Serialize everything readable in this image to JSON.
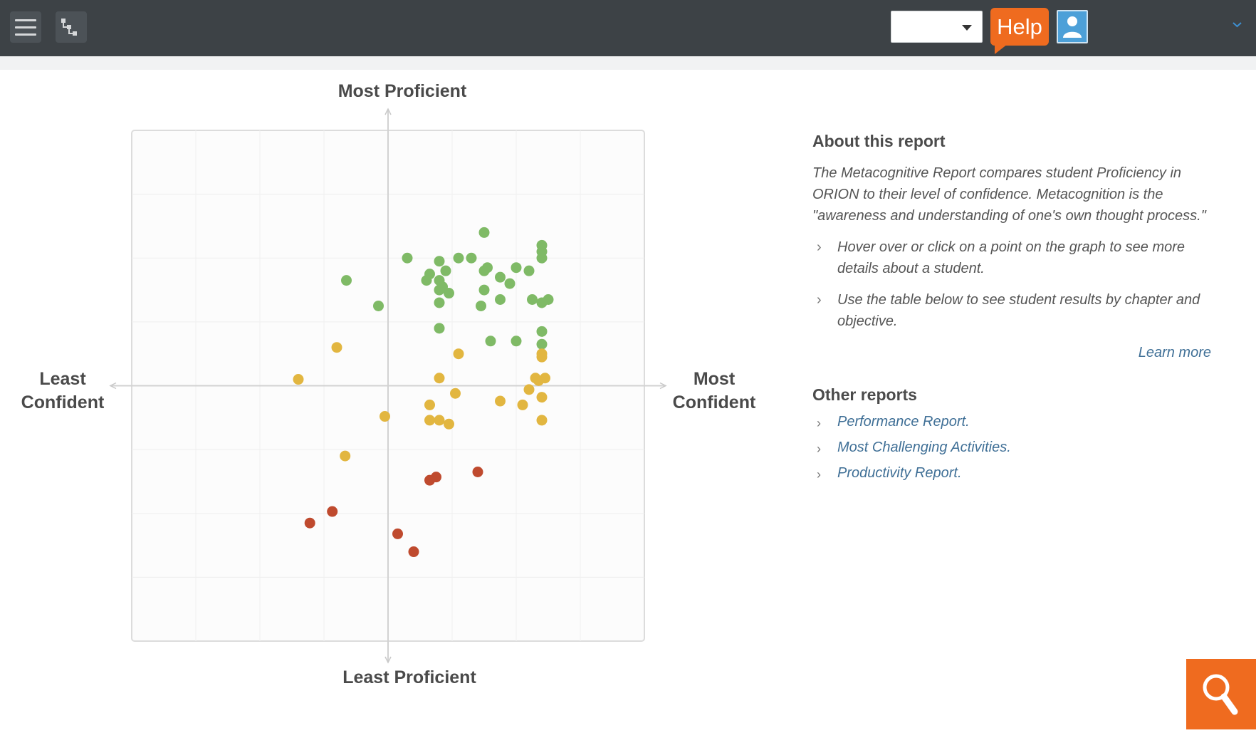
{
  "header": {
    "select_value": "",
    "help_label": "Help",
    "icons": [
      "menu-icon",
      "hierarchy-icon",
      "user-icon",
      "chevron-down-icon"
    ]
  },
  "chart": {
    "top_label": "Most Proficient",
    "bottom_label": "Least Proficient",
    "left_label_line1": "Least",
    "left_label_line2": "Confident",
    "right_label_line1": "Most",
    "right_label_line2": "Confident"
  },
  "chart_data": {
    "type": "scatter",
    "xlabel": "Confidence",
    "ylabel": "Proficiency",
    "xlim": [
      -4,
      4
    ],
    "ylim": [
      -4,
      4
    ],
    "grid": true,
    "colors": {
      "high": "#7fba66",
      "mid": "#e2b640",
      "low": "#bf4a2e"
    },
    "series": [
      {
        "group": "high",
        "points": [
          [
            1.5,
            2.4
          ],
          [
            2.4,
            2.2
          ],
          [
            2.4,
            2.1
          ],
          [
            2.4,
            2.0
          ],
          [
            0.3,
            2.0
          ],
          [
            0.8,
            1.95
          ],
          [
            1.1,
            2.0
          ],
          [
            1.3,
            2.0
          ],
          [
            2.0,
            1.85
          ],
          [
            2.2,
            1.8
          ],
          [
            1.55,
            1.85
          ],
          [
            1.5,
            1.8
          ],
          [
            0.65,
            1.75
          ],
          [
            1.75,
            1.7
          ],
          [
            0.9,
            1.8
          ],
          [
            0.6,
            1.65
          ],
          [
            0.8,
            1.65
          ],
          [
            1.9,
            1.6
          ],
          [
            0.85,
            1.55
          ],
          [
            0.8,
            1.5
          ],
          [
            0.95,
            1.45
          ],
          [
            1.5,
            1.5
          ],
          [
            -0.65,
            1.65
          ],
          [
            2.25,
            1.35
          ],
          [
            1.75,
            1.35
          ],
          [
            2.5,
            1.35
          ],
          [
            2.4,
            1.3
          ],
          [
            0.8,
            1.3
          ],
          [
            1.45,
            1.25
          ],
          [
            -0.15,
            1.25
          ],
          [
            0.8,
            0.9
          ],
          [
            2.4,
            0.85
          ],
          [
            1.6,
            0.7
          ],
          [
            2.0,
            0.7
          ],
          [
            2.4,
            0.65
          ]
        ]
      },
      {
        "group": "mid",
        "points": [
          [
            -0.8,
            0.6
          ],
          [
            1.1,
            0.5
          ],
          [
            2.4,
            0.5
          ],
          [
            2.4,
            0.45
          ],
          [
            -1.4,
            0.1
          ],
          [
            0.8,
            0.12
          ],
          [
            2.3,
            0.12
          ],
          [
            2.45,
            0.12
          ],
          [
            2.35,
            0.08
          ],
          [
            2.2,
            -0.06
          ],
          [
            1.05,
            -0.12
          ],
          [
            2.4,
            -0.18
          ],
          [
            1.75,
            -0.24
          ],
          [
            2.1,
            -0.3
          ],
          [
            0.65,
            -0.3
          ],
          [
            -0.05,
            -0.48
          ],
          [
            0.65,
            -0.54
          ],
          [
            0.8,
            -0.54
          ],
          [
            0.95,
            -0.6
          ],
          [
            2.4,
            -0.54
          ],
          [
            -0.67,
            -1.1
          ]
        ]
      },
      {
        "group": "low",
        "points": [
          [
            1.4,
            -1.35
          ],
          [
            0.75,
            -1.43
          ],
          [
            0.65,
            -1.48
          ],
          [
            -0.87,
            -1.97
          ],
          [
            -1.22,
            -2.15
          ],
          [
            0.15,
            -2.32
          ],
          [
            0.4,
            -2.6
          ]
        ]
      }
    ]
  },
  "about": {
    "title": "About this report",
    "description": "The Metacognitive Report compares student Proficiency in ORION to their level of confidence. Metacognition is the \"awareness and understanding of one's own thought process.\"",
    "bullets": [
      "Hover over or click on a point on the graph to see more details about a student.",
      "Use the table below to see student results by chapter and objective."
    ],
    "learn_more": "Learn more"
  },
  "other_reports": {
    "title": "Other reports",
    "links": [
      "Performance Report.",
      "Most Challenging Activities.",
      "Productivity Report."
    ]
  },
  "fab": {
    "icon": "search-icon"
  }
}
